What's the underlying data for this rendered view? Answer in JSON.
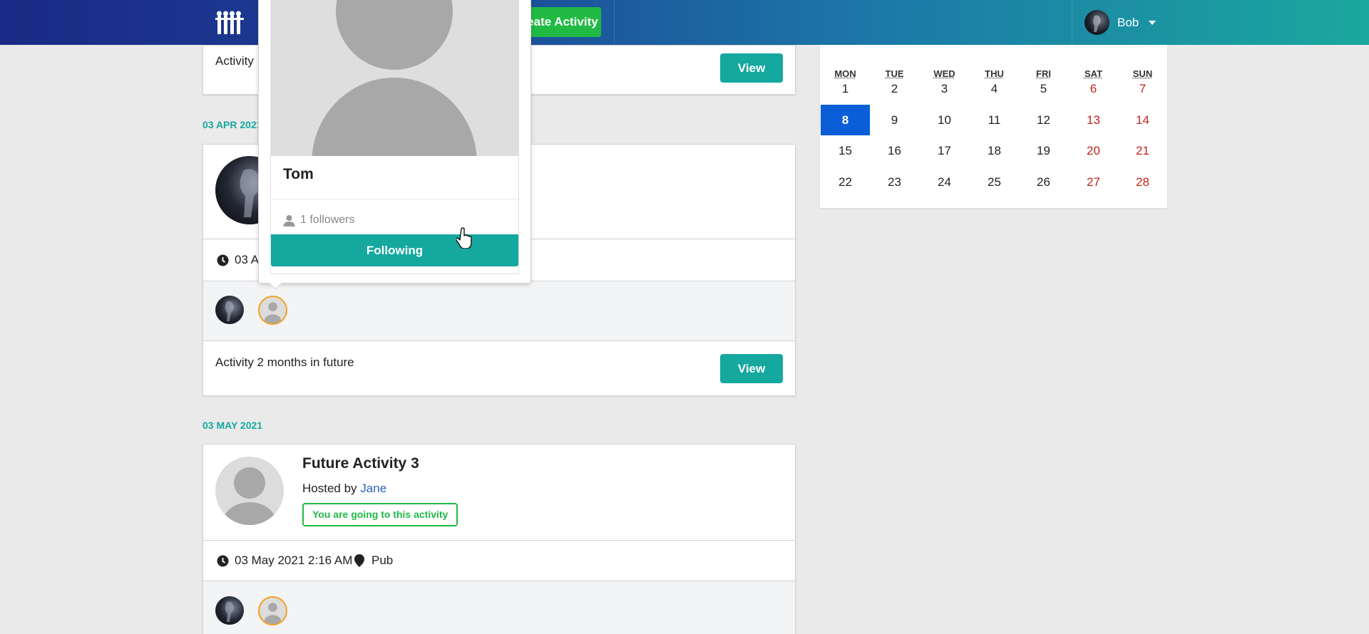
{
  "navbar": {
    "create_label": "Create Activity",
    "user_name": "Bob"
  },
  "feed": {
    "top_item": {
      "description": "Activity",
      "view_label": "View"
    },
    "groups": [
      {
        "date": "03 APR 2021",
        "attendee_time": "03 A",
        "description": "Activity 2 months in future",
        "view_label": "View"
      },
      {
        "date": "03 MAY 2021",
        "title": "Future Activity 3",
        "hosted_by_prefix": "Hosted by",
        "host": "Jane",
        "going_label": "You are going to this activity",
        "datetime": "03 May 2021 2:16 AM",
        "venue": "Pub"
      }
    ]
  },
  "profile_popup": {
    "name": "Tom",
    "followers": "1 followers",
    "button_label": "Following"
  },
  "calendar": {
    "headers": [
      "MON",
      "TUE",
      "WED",
      "THU",
      "FRI",
      "SAT",
      "SUN"
    ],
    "weeks": [
      [
        "1",
        "2",
        "3",
        "4",
        "5",
        "6",
        "7"
      ],
      [
        "8",
        "9",
        "10",
        "11",
        "12",
        "13",
        "14"
      ],
      [
        "15",
        "16",
        "17",
        "18",
        "19",
        "20",
        "21"
      ],
      [
        "22",
        "23",
        "24",
        "25",
        "26",
        "27",
        "28"
      ]
    ],
    "today": "8",
    "weekend_color": "#c0231e",
    "today_color": "#0a5fd8"
  },
  "colors": {
    "teal": "#14a89f",
    "green": "#21ba45",
    "nav_start": "#1a2a85",
    "nav_end": "#1aa89e"
  }
}
